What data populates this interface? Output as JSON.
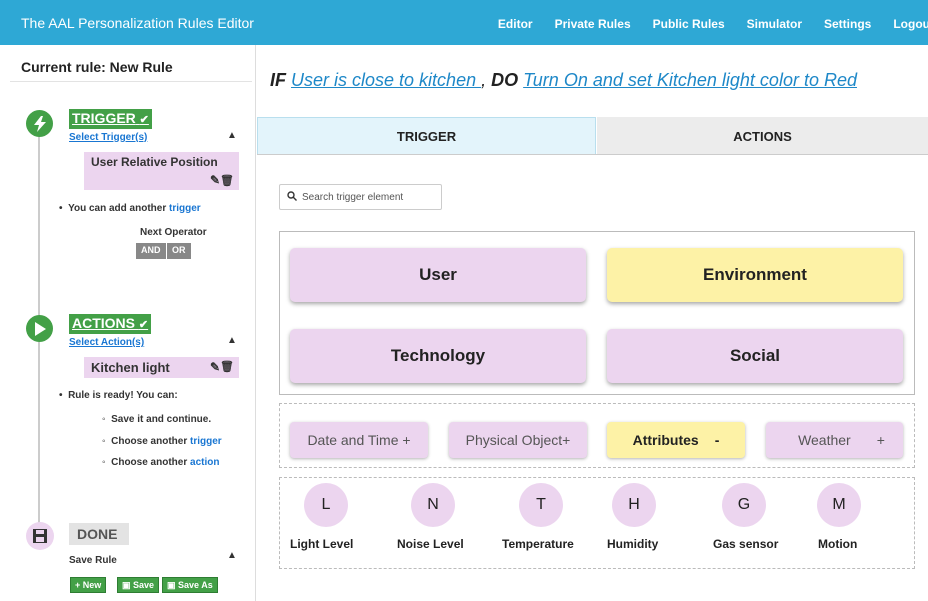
{
  "navbar": {
    "brand": "The AAL Personalization Rules Editor",
    "items": [
      "Editor",
      "Private Rules",
      "Public Rules",
      "Simulator",
      "Settings",
      "Logout"
    ]
  },
  "sidebar": {
    "current_rule": "Current rule: New Rule",
    "trigger": {
      "title": "TRIGGER",
      "select": "Select Trigger(s)",
      "chip": "User Relative Position",
      "hint_prefix": "You can add another ",
      "hint_link": "trigger",
      "next_operator": "Next Operator",
      "and": "AND",
      "or": "OR"
    },
    "actions": {
      "title": "ACTIONS",
      "select": "Select Action(s)",
      "chip": "Kitchen light",
      "ready": "Rule is ready! You can:",
      "opt1": "Save it and continue.",
      "opt2_prefix": "Choose another ",
      "opt2_link": "trigger",
      "opt3_prefix": "Choose another ",
      "opt3_link": "action"
    },
    "done": {
      "title": "DONE",
      "save_rule": "Save Rule",
      "new": "New",
      "save": "Save",
      "save_as": "Save As"
    }
  },
  "rule_heading": {
    "if": "IF",
    "trigger_text": "User is close to kitchen ",
    "comma": ",",
    "do": "DO",
    "action_text": "Turn On and set Kitchen light color to Red"
  },
  "tabs": {
    "trigger": "TRIGGER",
    "actions": "ACTIONS"
  },
  "search": {
    "placeholder": "Search trigger element"
  },
  "categories": {
    "user": "User",
    "environment": "Environment",
    "technology": "Technology",
    "social": "Social"
  },
  "subcategories": {
    "date_time": "Date and Time +",
    "physical_object": "Physical Object+",
    "attributes": "Attributes",
    "attributes_toggle": "-",
    "weather": "Weather",
    "weather_toggle": "+"
  },
  "attributes": [
    {
      "letter": "L",
      "label": "Light Level"
    },
    {
      "letter": "N",
      "label": "Noise Level"
    },
    {
      "letter": "T",
      "label": "Temperature"
    },
    {
      "letter": "H",
      "label": "Humidity"
    },
    {
      "letter": "G",
      "label": "Gas sensor"
    },
    {
      "letter": "M",
      "label": "Motion"
    }
  ],
  "colors": {
    "navbar": "#2ea8d5",
    "step_green": "#43a047",
    "purple": "#ecd5ef",
    "yellow": "#fdf2a6",
    "link": "#1e88c8"
  }
}
